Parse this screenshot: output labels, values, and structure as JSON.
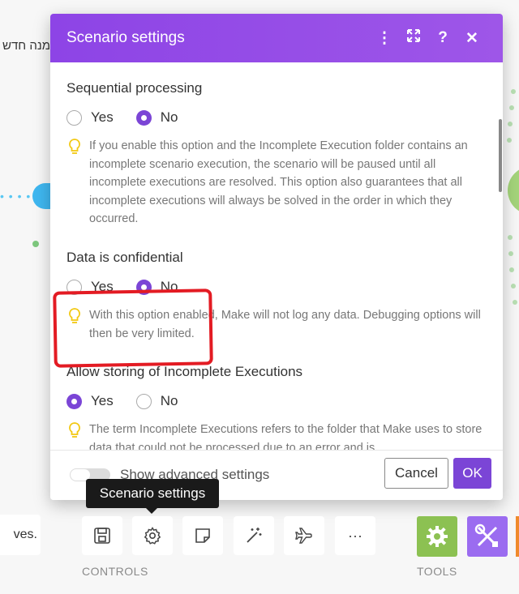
{
  "background": {
    "hebrew_text": "מנה חדש",
    "dots": "• • • •"
  },
  "modal": {
    "title": "Scenario settings",
    "header_icons": [
      "more-vertical-icon",
      "expand-icon",
      "help-icon",
      "close-icon"
    ],
    "header_icon_glyphs": [
      "⋮",
      "⤢",
      "?",
      "✕"
    ],
    "sections": [
      {
        "label": "Sequential processing",
        "options": [
          "Yes",
          "No"
        ],
        "selected": "No",
        "hint": "If you enable this option and the Incomplete Execution folder contains an incomplete scenario execution, the scenario will be paused until all incomplete executions are resolved. This option also guarantees that all incomplete executions will always be solved in the order in which they occurred."
      },
      {
        "label": "Data is confidential",
        "options": [
          "Yes",
          "No"
        ],
        "selected": "No",
        "hint": "With this option enabled, Make will not log any data. Debugging options will then be very limited."
      },
      {
        "label": "Allow storing of Incomplete Executions",
        "options": [
          "Yes",
          "No"
        ],
        "selected": "Yes",
        "hint": "The term Incomplete Executions refers to the folder that Make uses to store data that could not be processed due to an error and is"
      }
    ],
    "footer": {
      "advanced_label": "Show advanced settings",
      "advanced_enabled": false,
      "cancel_label": "Cancel",
      "ok_label": "OK"
    }
  },
  "tooltip": "Scenario settings",
  "toolbar": {
    "left_text": "ves.",
    "controls_caption": "CONTROLS",
    "tools_caption": "TOOLS",
    "controls": [
      "save-icon",
      "gear-icon",
      "note-icon",
      "magic-wand-icon",
      "airplane-icon",
      "more-horizontal-icon"
    ],
    "more_glyph": "···"
  },
  "colors": {
    "header_purple": "#8d44e6",
    "accent_purple": "#7b45d6",
    "highlight_red": "#e31b23",
    "tools_green": "#8cc152",
    "tools_purple": "#9b6cf0"
  }
}
